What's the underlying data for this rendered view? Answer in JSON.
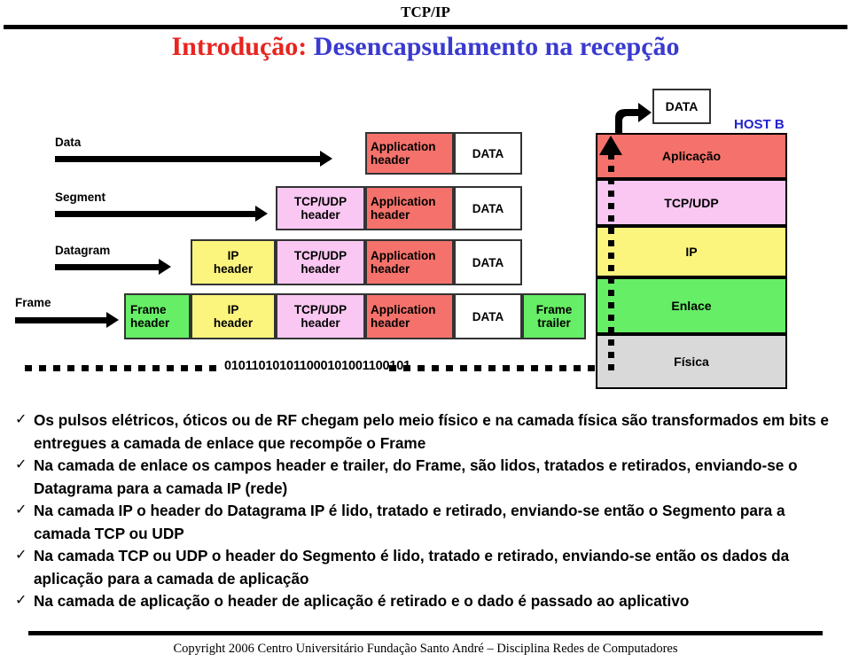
{
  "header": {
    "title": "TCP/IP"
  },
  "title": {
    "red_part": "Introdução:",
    "blue_part": "Desencapsulamento na recepção"
  },
  "diagram": {
    "host_label": "HOST B",
    "top_data_box": "DATA",
    "row_labels": [
      "Data",
      "Segment",
      "Datagram",
      "Frame"
    ],
    "rows": [
      {
        "name": "data-row",
        "cells": [
          {
            "label": "Application\nheader",
            "color": "#f4726b"
          },
          {
            "label": "DATA",
            "color": "#ffffff"
          }
        ]
      },
      {
        "name": "segment-row",
        "cells": [
          {
            "label": "TCP/UDP\nheader",
            "color": "#f9c7f2"
          },
          {
            "label": "Application\nheader",
            "color": "#f4726b"
          },
          {
            "label": "DATA",
            "color": "#ffffff"
          }
        ]
      },
      {
        "name": "datagram-row",
        "cells": [
          {
            "label": "IP\nheader",
            "color": "#fbf57e"
          },
          {
            "label": "TCP/UDP\nheader",
            "color": "#f9c7f2"
          },
          {
            "label": "Application\nheader",
            "color": "#f4726b"
          },
          {
            "label": "DATA",
            "color": "#ffffff"
          }
        ]
      },
      {
        "name": "frame-row",
        "cells": [
          {
            "label": "Frame\nheader",
            "color": "#66ee66"
          },
          {
            "label": "IP\nheader",
            "color": "#fbf57e"
          },
          {
            "label": "TCP/UDP\nheader",
            "color": "#f9c7f2"
          },
          {
            "label": "Application\nheader",
            "color": "#f4726b"
          },
          {
            "label": "DATA",
            "color": "#ffffff"
          },
          {
            "label": "Frame\ntrailer",
            "color": "#66ee66"
          }
        ]
      }
    ],
    "stack": [
      {
        "label": "Aplicação",
        "color": "#f4726b"
      },
      {
        "label": "TCP/UDP",
        "color": "#f9c7f2"
      },
      {
        "label": "IP",
        "color": "#fbf57e"
      },
      {
        "label": "Enlace",
        "color": "#66ee66"
      },
      {
        "label": "Física",
        "color": "#d9d9d9"
      }
    ],
    "binary_stream": "010110101011000101001100101"
  },
  "bullets": [
    "Os pulsos elétricos, óticos ou de RF chegam pelo meio físico e na camada física são transformados em bits e entregues a camada de enlace que recompõe o Frame",
    "Na camada de enlace os campos header e trailer, do Frame,  são lidos, tratados e retirados, enviando-se o Datagrama para a camada IP (rede)",
    "Na camada IP o header do Datagrama IP é lido, tratado e retirado, enviando-se então o Segmento para a camada TCP ou UDP",
    "Na camada TCP ou UDP o header do Segmento é lido, tratado e retirado, enviando-se então os dados da aplicação para a camada de aplicação",
    "Na camada de aplicação o header de aplicação é retirado e o dado é passado ao aplicativo"
  ],
  "bullet_marker": "✓",
  "footer": {
    "text": "Copyright 2006 Centro Universitário Fundação Santo André – Disciplina Redes de Computadores"
  }
}
